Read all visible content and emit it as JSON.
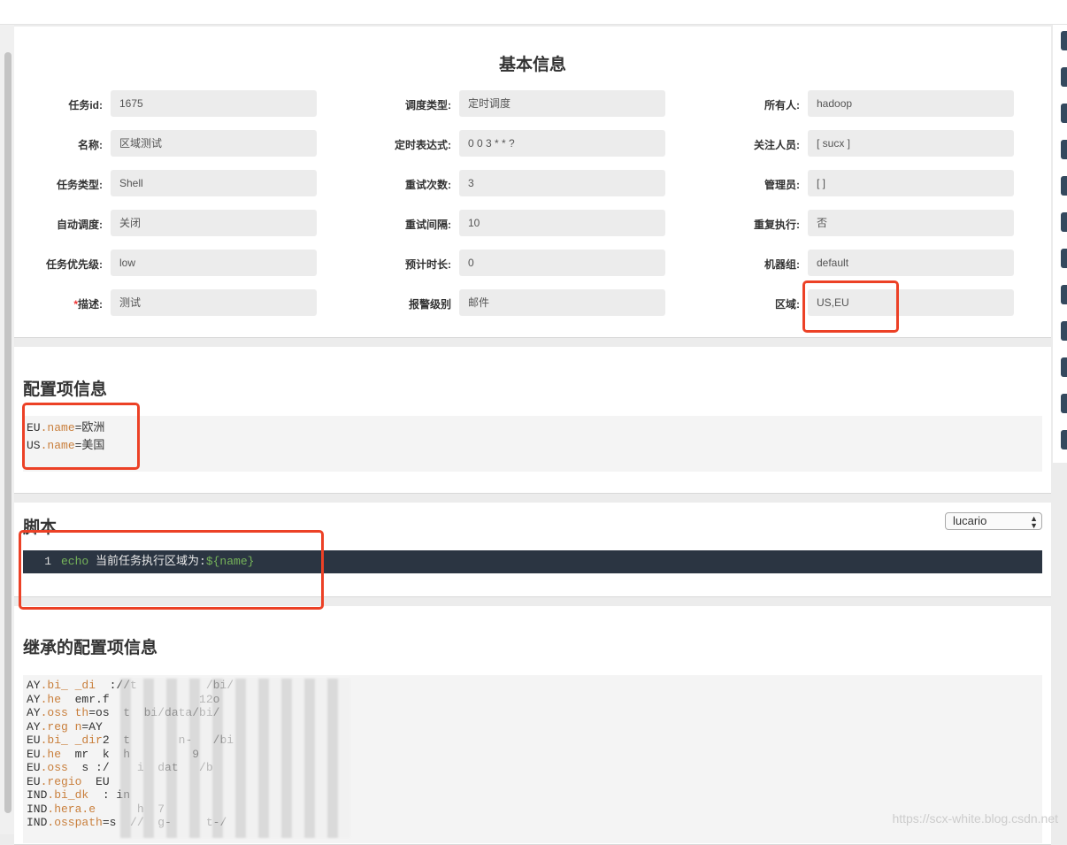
{
  "basic_info": {
    "title": "基本信息",
    "fields": [
      {
        "label": "任务id:",
        "value": "1675"
      },
      {
        "label": "调度类型:",
        "value": "定时调度"
      },
      {
        "label": "所有人:",
        "value": "hadoop"
      },
      {
        "label": "名称:",
        "value": "区域测试"
      },
      {
        "label": "定时表达式:",
        "value": "0 0 3 * * ?"
      },
      {
        "label": "关注人员:",
        "value": "[ sucx ]"
      },
      {
        "label": "任务类型:",
        "value": "Shell"
      },
      {
        "label": "重试次数:",
        "value": "3"
      },
      {
        "label": "管理员:",
        "value": "[ ]"
      },
      {
        "label": "自动调度:",
        "value": "关闭"
      },
      {
        "label": "重试间隔:",
        "value": "10"
      },
      {
        "label": "重复执行:",
        "value": "否"
      },
      {
        "label": "任务优先级:",
        "value": "low"
      },
      {
        "label": "预计时长:",
        "value": "0"
      },
      {
        "label": "机器组:",
        "value": "default"
      },
      {
        "label": "描述:",
        "required_mark": "*",
        "value": "测试"
      },
      {
        "label": "报警级别",
        "value": "邮件"
      },
      {
        "label": "区域:",
        "value": "US,EU"
      }
    ]
  },
  "config": {
    "title": "配置项信息",
    "lines": [
      {
        "prefix": "EU",
        "key": ".name",
        "value": "=欧洲"
      },
      {
        "prefix": "US",
        "key": ".name",
        "value": "=美国"
      }
    ]
  },
  "script": {
    "title": "脚本",
    "theme_select": "lucario",
    "line_number": "1",
    "keyword": "echo",
    "text": " 当前任务执行区域为:",
    "variable": "${name}"
  },
  "inherited": {
    "title": "继承的配置项信息",
    "lines": [
      {
        "prefix": "AY",
        "key": ".bi_ _di",
        "value": "  ://t          /bi/"
      },
      {
        "prefix": "AY",
        "key": ".he",
        "value": "  emr.f             12o"
      },
      {
        "prefix": "AY",
        "key": ".oss th",
        "value": "=os  t  bi/data/bi/"
      },
      {
        "prefix": "AY",
        "key": ".reg n",
        "value": "=AY"
      },
      {
        "prefix": "EU",
        "key": ".bi_ _dir",
        "value": "2  t       n-   /bi"
      },
      {
        "prefix": "EU",
        "key": ".he",
        "value": "  mr  k  h         9"
      },
      {
        "prefix": "EU",
        "key": ".oss",
        "value": "  s :/    i  dat   /b"
      },
      {
        "prefix": "EU",
        "key": ".regio",
        "value": "  EU"
      },
      {
        "prefix": "IND",
        "key": ".bi_dk",
        "value": "  : in"
      },
      {
        "prefix": "IND",
        "key": ".hera.e",
        "value": "      h  7"
      },
      {
        "prefix": "IND",
        "key": ".osspath",
        "value": "=s  //  g-     t-/"
      }
    ]
  },
  "watermark": "https://scx-white.blog.csdn.net",
  "colors": {
    "accent_red": "#ec4126",
    "editor_bg": "#2b3542",
    "key_orange": "#c97f3c",
    "code_green": "#76b45a",
    "sidebar_tab": "#34495e"
  }
}
